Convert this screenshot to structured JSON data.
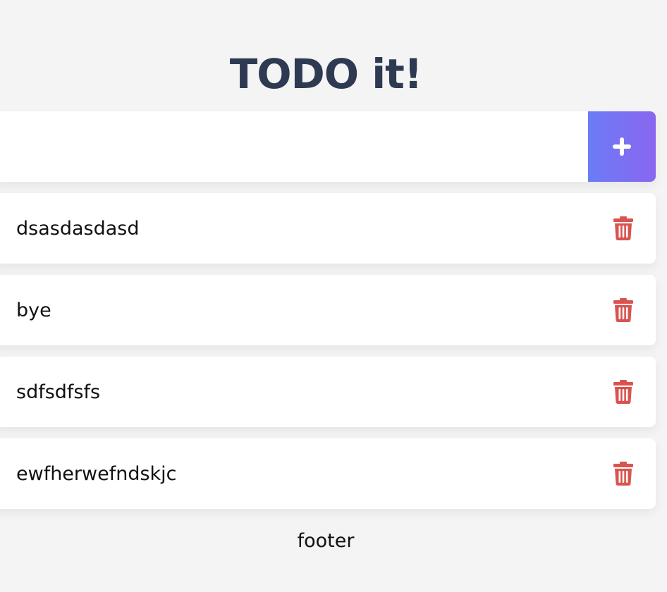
{
  "header": {
    "title": "TODO it!"
  },
  "input": {
    "value": "",
    "placeholder": "",
    "add_icon": "plus-icon",
    "add_color_start": "#6b7cf6",
    "add_color_end": "#8a66f0"
  },
  "todos": [
    {
      "text": "dsasdasdasd",
      "delete_icon": "trash-icon"
    },
    {
      "text": "bye",
      "delete_icon": "trash-icon"
    },
    {
      "text": "sdfsdfsfs",
      "delete_icon": "trash-icon"
    },
    {
      "text": "ewfherwefndskjc",
      "delete_icon": "trash-icon"
    }
  ],
  "colors": {
    "title": "#2e3a52",
    "delete": "#d9534f",
    "background": "#f4f4f4"
  },
  "footer": {
    "text": "footer"
  }
}
